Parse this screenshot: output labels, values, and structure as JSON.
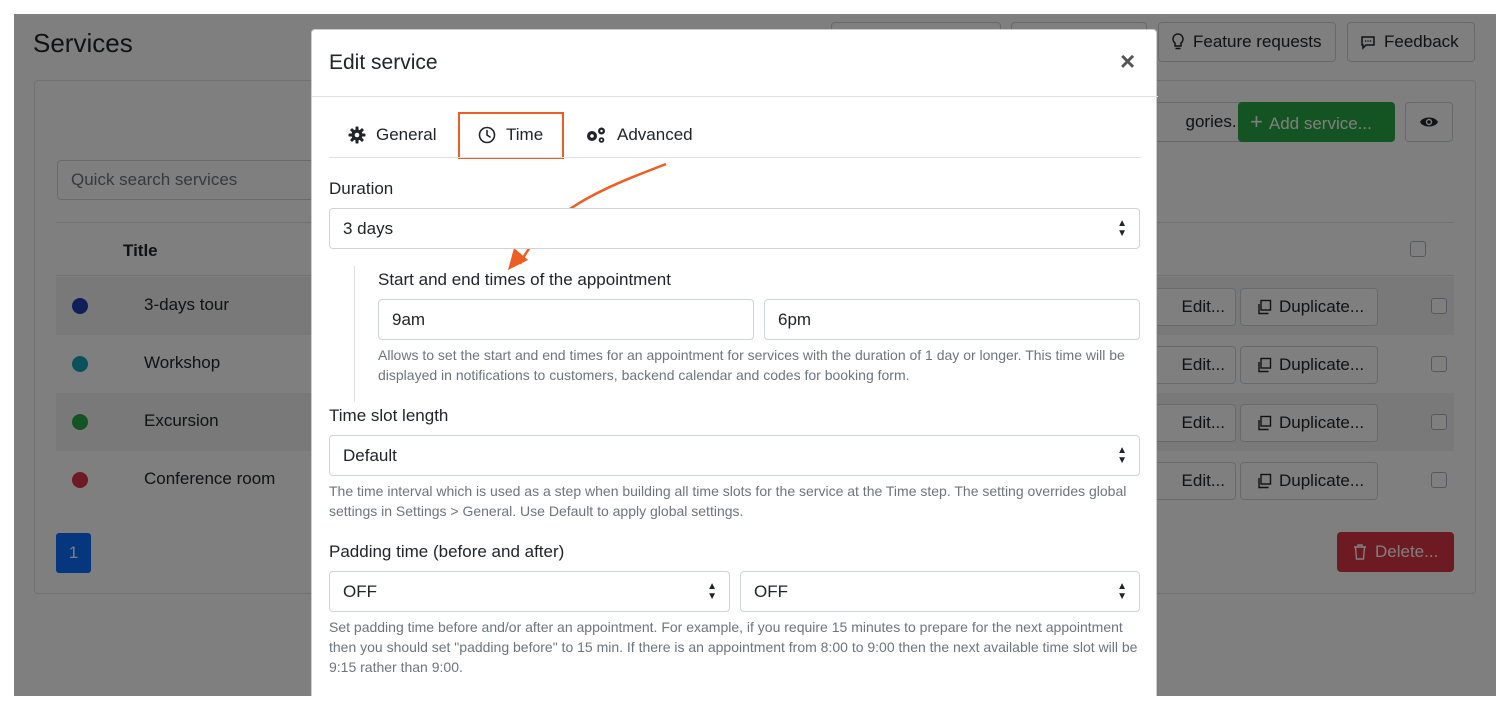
{
  "page": {
    "title": "Services",
    "top_buttons": [
      "Feature requests",
      "Feedback"
    ],
    "search_placeholder": "Quick search services",
    "categories_button": "gories...",
    "add_button": "Add service...",
    "table_header_title": "Title",
    "rows": [
      {
        "title": "3-days tour",
        "color": "#1f3fb5",
        "edit": "Edit...",
        "duplicate": "Duplicate..."
      },
      {
        "title": "Workshop",
        "color": "#17a2b8",
        "edit": "Edit...",
        "duplicate": "Duplicate..."
      },
      {
        "title": "Excursion",
        "color": "#28a745",
        "edit": "Edit...",
        "duplicate": "Duplicate..."
      },
      {
        "title": "Conference room",
        "color": "#dc3545",
        "edit": "Edit...",
        "duplicate": "Duplicate..."
      }
    ],
    "pagination": "1",
    "delete_button": "Delete..."
  },
  "modal": {
    "title": "Edit service",
    "close": "×",
    "tabs": [
      {
        "label": "General",
        "icon": "gear-icon"
      },
      {
        "label": "Time",
        "icon": "clock-icon",
        "active": true
      },
      {
        "label": "Advanced",
        "icon": "gears-icon"
      }
    ],
    "duration": {
      "label": "Duration",
      "value": "3 days"
    },
    "start_end": {
      "label": "Start and end times of the appointment",
      "start": "9am",
      "end": "6pm",
      "help": "Allows to set the start and end times for an appointment for services with the duration of 1 day or longer. This time will be displayed in notifications to customers, backend calendar and codes for booking form."
    },
    "slot_length": {
      "label": "Time slot length",
      "value": "Default",
      "help": "The time interval which is used as a step when building all time slots for the service at the Time step. The setting overrides global settings in Settings > General. Use Default to apply global settings."
    },
    "padding": {
      "label": "Padding time (before and after)",
      "before": "OFF",
      "after": "OFF",
      "help": "Set padding time before and/or after an appointment. For example, if you require 15 minutes to prepare for the next appointment then you should set \"padding before\" to 15 min. If there is an appointment from 8:00 to 9:00 then the next available time slot will be 9:15 rather than 9:00."
    }
  },
  "colors": {
    "accent": "#f05d23",
    "primary": "#0d6efd",
    "success": "#28a745",
    "danger": "#dc3545"
  }
}
